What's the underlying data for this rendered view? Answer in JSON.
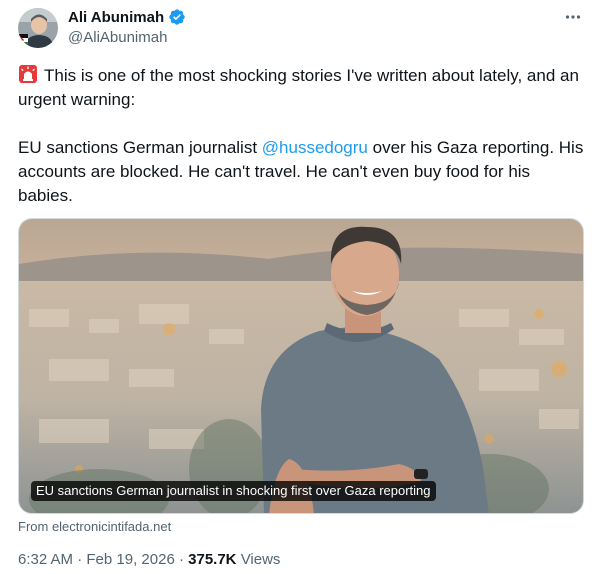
{
  "author": {
    "name": "Ali Abunimah",
    "handle": "@AliAbunimah"
  },
  "tweet": {
    "line1": "This is one of the most shocking stories I've written about lately, and an urgent warning:",
    "line2_prefix": "EU sanctions German journalist ",
    "mention": "@hussedogru",
    "line2_suffix": " over his Gaza reporting. His accounts are blocked. He can't travel. He can't even buy food for his babies."
  },
  "card": {
    "caption": "EU sanctions German journalist in shocking first over Gaza reporting",
    "source": "From electronicintifada.net"
  },
  "meta": {
    "time": "6:32 AM",
    "separator": "·",
    "date": "Feb 19, 2026",
    "views_count": "375.7K",
    "views_label": "Views"
  },
  "icons": {
    "verified": "verified-badge-icon",
    "more": "more-options-icon",
    "alarm": "rotating-light-icon"
  },
  "colors": {
    "link": "#1d9bf0",
    "verified": "#1d9bf0",
    "secondary_text": "#536471",
    "primary_text": "#0f1419"
  }
}
